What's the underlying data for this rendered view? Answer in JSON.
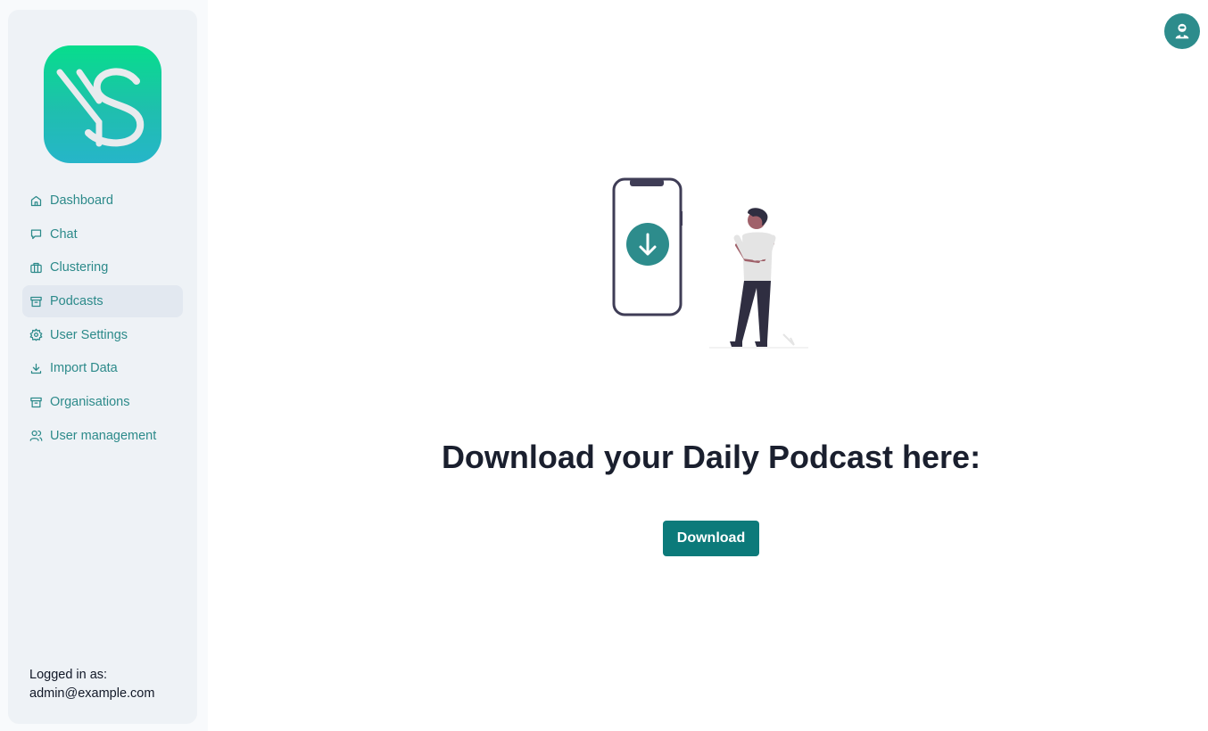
{
  "sidebar": {
    "logo": {
      "icon": "ys-logo"
    },
    "items": [
      {
        "label": "Dashboard",
        "icon": "home-icon",
        "active": false
      },
      {
        "label": "Chat",
        "icon": "chat-icon",
        "active": false
      },
      {
        "label": "Clustering",
        "icon": "briefcase-icon",
        "active": false
      },
      {
        "label": "Podcasts",
        "icon": "archive-icon",
        "active": true
      },
      {
        "label": "User Settings",
        "icon": "gear-icon",
        "active": false
      },
      {
        "label": "Import Data",
        "icon": "download-icon",
        "active": false
      },
      {
        "label": "Organisations",
        "icon": "archive-icon",
        "active": false
      },
      {
        "label": "User management",
        "icon": "users-icon",
        "active": false
      }
    ],
    "login": {
      "label": "Logged in as:",
      "email": "admin@example.com"
    }
  },
  "header": {
    "avatar_icon": "user-avatar-icon"
  },
  "main": {
    "headline": "Download your Daily Podcast here:",
    "download_label": "Download"
  },
  "colors": {
    "accent": "#0c7a7a",
    "nav_text": "#2c8a8a",
    "sidebar_bg": "#eef2f6",
    "active_item_bg": "#e2e8f0"
  }
}
